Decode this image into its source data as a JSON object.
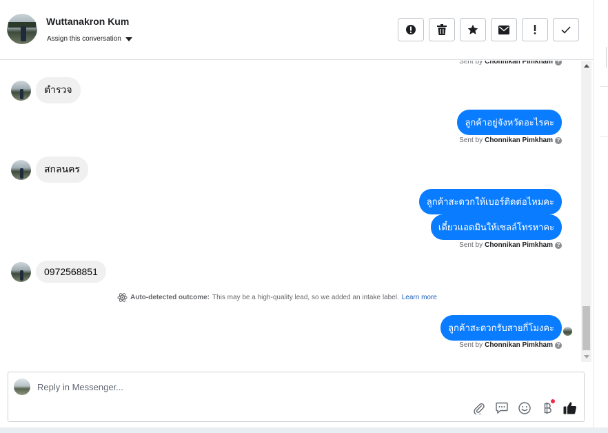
{
  "header": {
    "contact_name": "Wuttanakron Kum",
    "assign_label": "Assign this conversation",
    "toolbar": [
      {
        "icon": "alert-circle-icon"
      },
      {
        "icon": "trash-icon"
      },
      {
        "icon": "star-icon"
      },
      {
        "icon": "envelope-icon"
      },
      {
        "icon": "exclamation-icon"
      },
      {
        "icon": "check-icon"
      }
    ]
  },
  "thread": {
    "sent_by_prefix": "Sent by",
    "agent_name": "Chonnikan Pimkham",
    "messages": [
      {
        "direction": "in",
        "text": "ตำรวจ"
      },
      {
        "direction": "out",
        "text": "ลูกค้าอยู่จังหวัดอะไรคะ"
      },
      {
        "direction": "in",
        "text": "สกลนคร"
      },
      {
        "direction": "out",
        "text": "ลูกค้าสะดวกให้เบอร์ติดต่อไหมคะ"
      },
      {
        "direction": "out",
        "text": "เดี๋ยวแอดมินให้เซลล์โทรหาคะ"
      },
      {
        "direction": "in",
        "text": "0972568851"
      },
      {
        "direction": "out",
        "text": "ลูกค้าสะดวกรับสายกี่โมงคะ"
      }
    ],
    "auto_detected": {
      "label": "Auto-detected outcome:",
      "text": "This may be a high-quality lead, so we added an intake label.",
      "link": "Learn more"
    }
  },
  "composer": {
    "placeholder": "Reply in Messenger...",
    "icons": [
      "attachment-icon",
      "saved-reply-icon",
      "emoji-icon",
      "baht-payment-icon",
      "thumbs-up-icon"
    ]
  },
  "colors": {
    "outgoing_bubble": "#0a7cff",
    "incoming_bubble": "#f0f0f0",
    "link": "#1a5eb8",
    "notification_dot": "#f02849"
  }
}
